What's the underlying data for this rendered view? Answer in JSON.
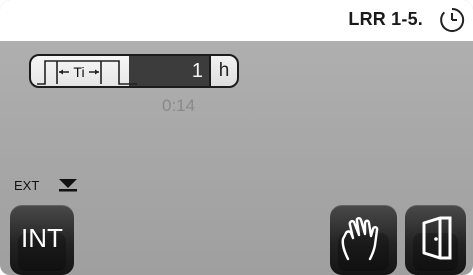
{
  "header": {
    "title": "LRR 1-5.",
    "status_icon": "clock-icon"
  },
  "parameter": {
    "symbol_label": "Ti",
    "symbol_icon": "time-interval-icon",
    "value": "1",
    "unit": "h",
    "fill_fraction": 0.55,
    "elapsed": "0:14"
  },
  "ext": {
    "label": "EXT",
    "icon": "triangle-down-icon"
  },
  "footer": {
    "int_label": "INT",
    "manual_icon": "hand-icon",
    "exit_icon": "exit-door-icon"
  },
  "colors": {
    "background": "#a8a8a8",
    "header": "#ffffff",
    "button": "#232323"
  }
}
